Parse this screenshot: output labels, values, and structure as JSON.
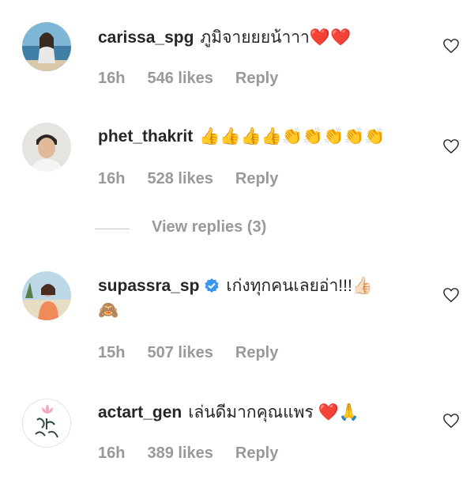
{
  "comments": [
    {
      "username": "carissa_spg",
      "text": "ภูมิจายยยน้าาา",
      "emoji": "❤️❤️",
      "time": "16h",
      "likes": "546 likes",
      "reply_label": "Reply",
      "avatar_icon": "beach-photo-avatar"
    },
    {
      "username": "phet_thakrit",
      "text": "",
      "emoji": "👍👍👍👍👏👏👏👏👏",
      "time": "16h",
      "likes": "528 likes",
      "reply_label": "Reply",
      "avatar_icon": "portrait-avatar"
    },
    {
      "username": "supassra_sp",
      "text": "เก่งทุกคนเลยอ่า!!!",
      "emoji": "👍🏻",
      "emoji_line2": "🙈",
      "time": "15h",
      "likes": "507 likes",
      "reply_label": "Reply",
      "avatar_icon": "beach-photo-avatar",
      "verified": true
    },
    {
      "username": "actart_gen",
      "text": "เล่นดีมากคุณแพร",
      "emoji": "❤️🙏",
      "time": "16h",
      "likes": "389 likes",
      "reply_label": "Reply",
      "avatar_icon": "lotus-logo-avatar"
    }
  ],
  "view_replies": "View replies (3)",
  "colors": {
    "text": "#262626",
    "meta": "#999999",
    "verified_blue": "#3897f0",
    "divider": "#c7c7c7"
  }
}
